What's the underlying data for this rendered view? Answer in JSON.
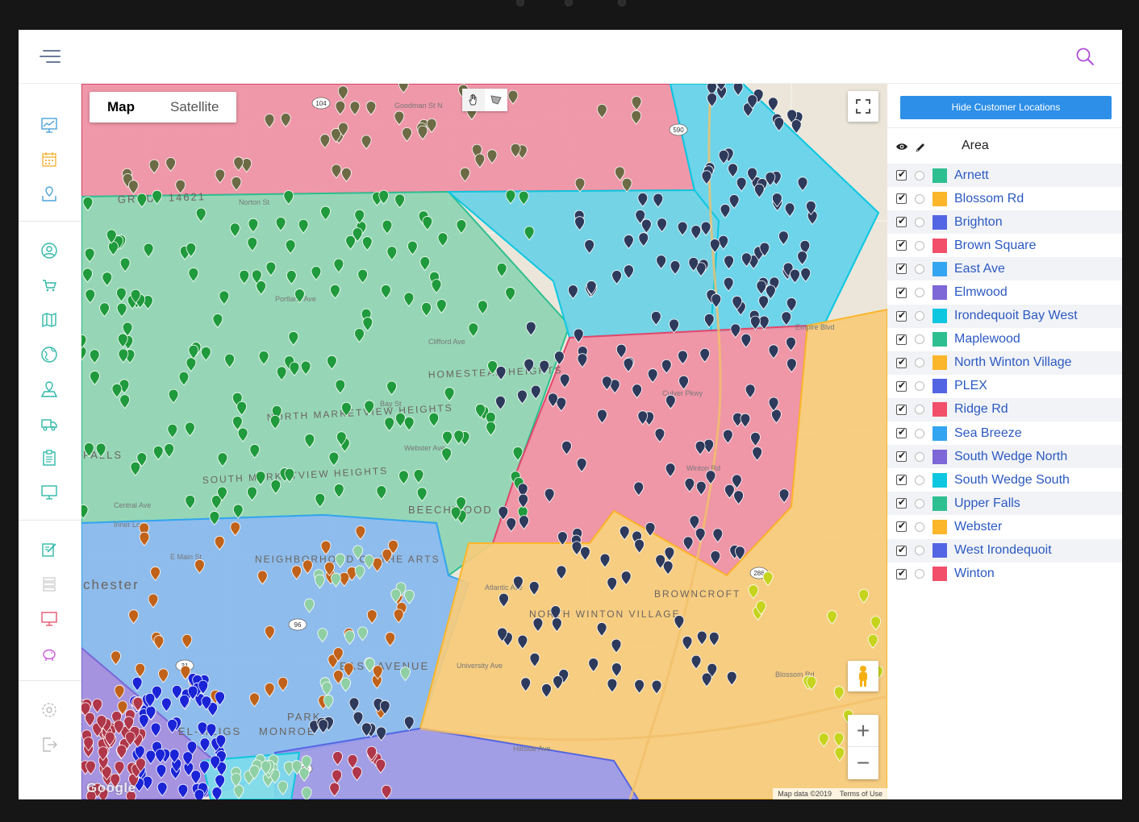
{
  "map_type": {
    "map_label": "Map",
    "satellite_label": "Satellite"
  },
  "map_labels": {
    "group": "GROUP 14621",
    "north_marketview": "NORTH MARKETVIEW HEIGHTS",
    "south_marketview": "SOUTH MARKETVIEW HEIGHTS",
    "beechwood": "BEECHWOOD",
    "homestead": "HOMESTEAD HEIGHTS",
    "neighborhood": "NEIGHBORHOOD OF THE ARTS",
    "east_avenue": "EAST AVENUE",
    "park": "PARK",
    "el_meigs": "EL-MEIGS",
    "monroe": "MONROE",
    "north_winton": "NORTH WINTON VILLAGE",
    "browncroft": "BROWNCROFT",
    "falls": "FALLS",
    "rochester": "chester",
    "streets": [
      "Norton St",
      "Clifford Ave",
      "Culver Pkwy",
      "Empire Blvd",
      "E Main St",
      "University Ave",
      "Atlantic Ave",
      "Hillside Ave",
      "Central Ave",
      "Inner Loop",
      "Bay St",
      "Webster Ave",
      "Portland Ave",
      "Goodman St N",
      "Winton Rd",
      "Blossom Rd"
    ],
    "shields": [
      "104",
      "590",
      "490",
      "96",
      "31",
      "286"
    ]
  },
  "attribution": {
    "map_data": "Map data ©2019",
    "terms": "Terms of Use",
    "logo": "Google"
  },
  "panel": {
    "hide_button": "Hide Customer Locations",
    "area_header": "Area",
    "areas": [
      {
        "name": "Arnett",
        "color": "#2ebf91"
      },
      {
        "name": "Blossom Rd",
        "color": "#fbb62a"
      },
      {
        "name": "Brighton",
        "color": "#5465e3"
      },
      {
        "name": "Brown Square",
        "color": "#f2506a"
      },
      {
        "name": "East Ave",
        "color": "#34a5f0"
      },
      {
        "name": "Elmwood",
        "color": "#7e67d6"
      },
      {
        "name": "Irondequoit Bay West",
        "color": "#0dc7e0"
      },
      {
        "name": "Maplewood",
        "color": "#2ebf91"
      },
      {
        "name": "North Winton Village",
        "color": "#fbb62a"
      },
      {
        "name": "PLEX",
        "color": "#5465e3"
      },
      {
        "name": "Ridge Rd",
        "color": "#f2506a"
      },
      {
        "name": "Sea Breeze",
        "color": "#34a5f0"
      },
      {
        "name": "South Wedge North",
        "color": "#7e67d6"
      },
      {
        "name": "South Wedge South",
        "color": "#0dc7e0"
      },
      {
        "name": "Upper Falls",
        "color": "#2ebf91"
      },
      {
        "name": "Webster",
        "color": "#fbb62a"
      },
      {
        "name": "West Irondequoit",
        "color": "#5465e3"
      },
      {
        "name": "Winton",
        "color": "#f2506a"
      }
    ]
  },
  "colors": {
    "accent": "#2d8fe8",
    "pin_dark": "#2e3a5c",
    "pin_green": "#1f9a3c",
    "pin_olive": "#6d6b45",
    "pin_orange": "#c0621a",
    "pin_blue": "#1a24d6",
    "pin_maroon": "#b0364a",
    "pin_mint": "#8fcfa4",
    "pin_yellow": "#c6d41e"
  }
}
